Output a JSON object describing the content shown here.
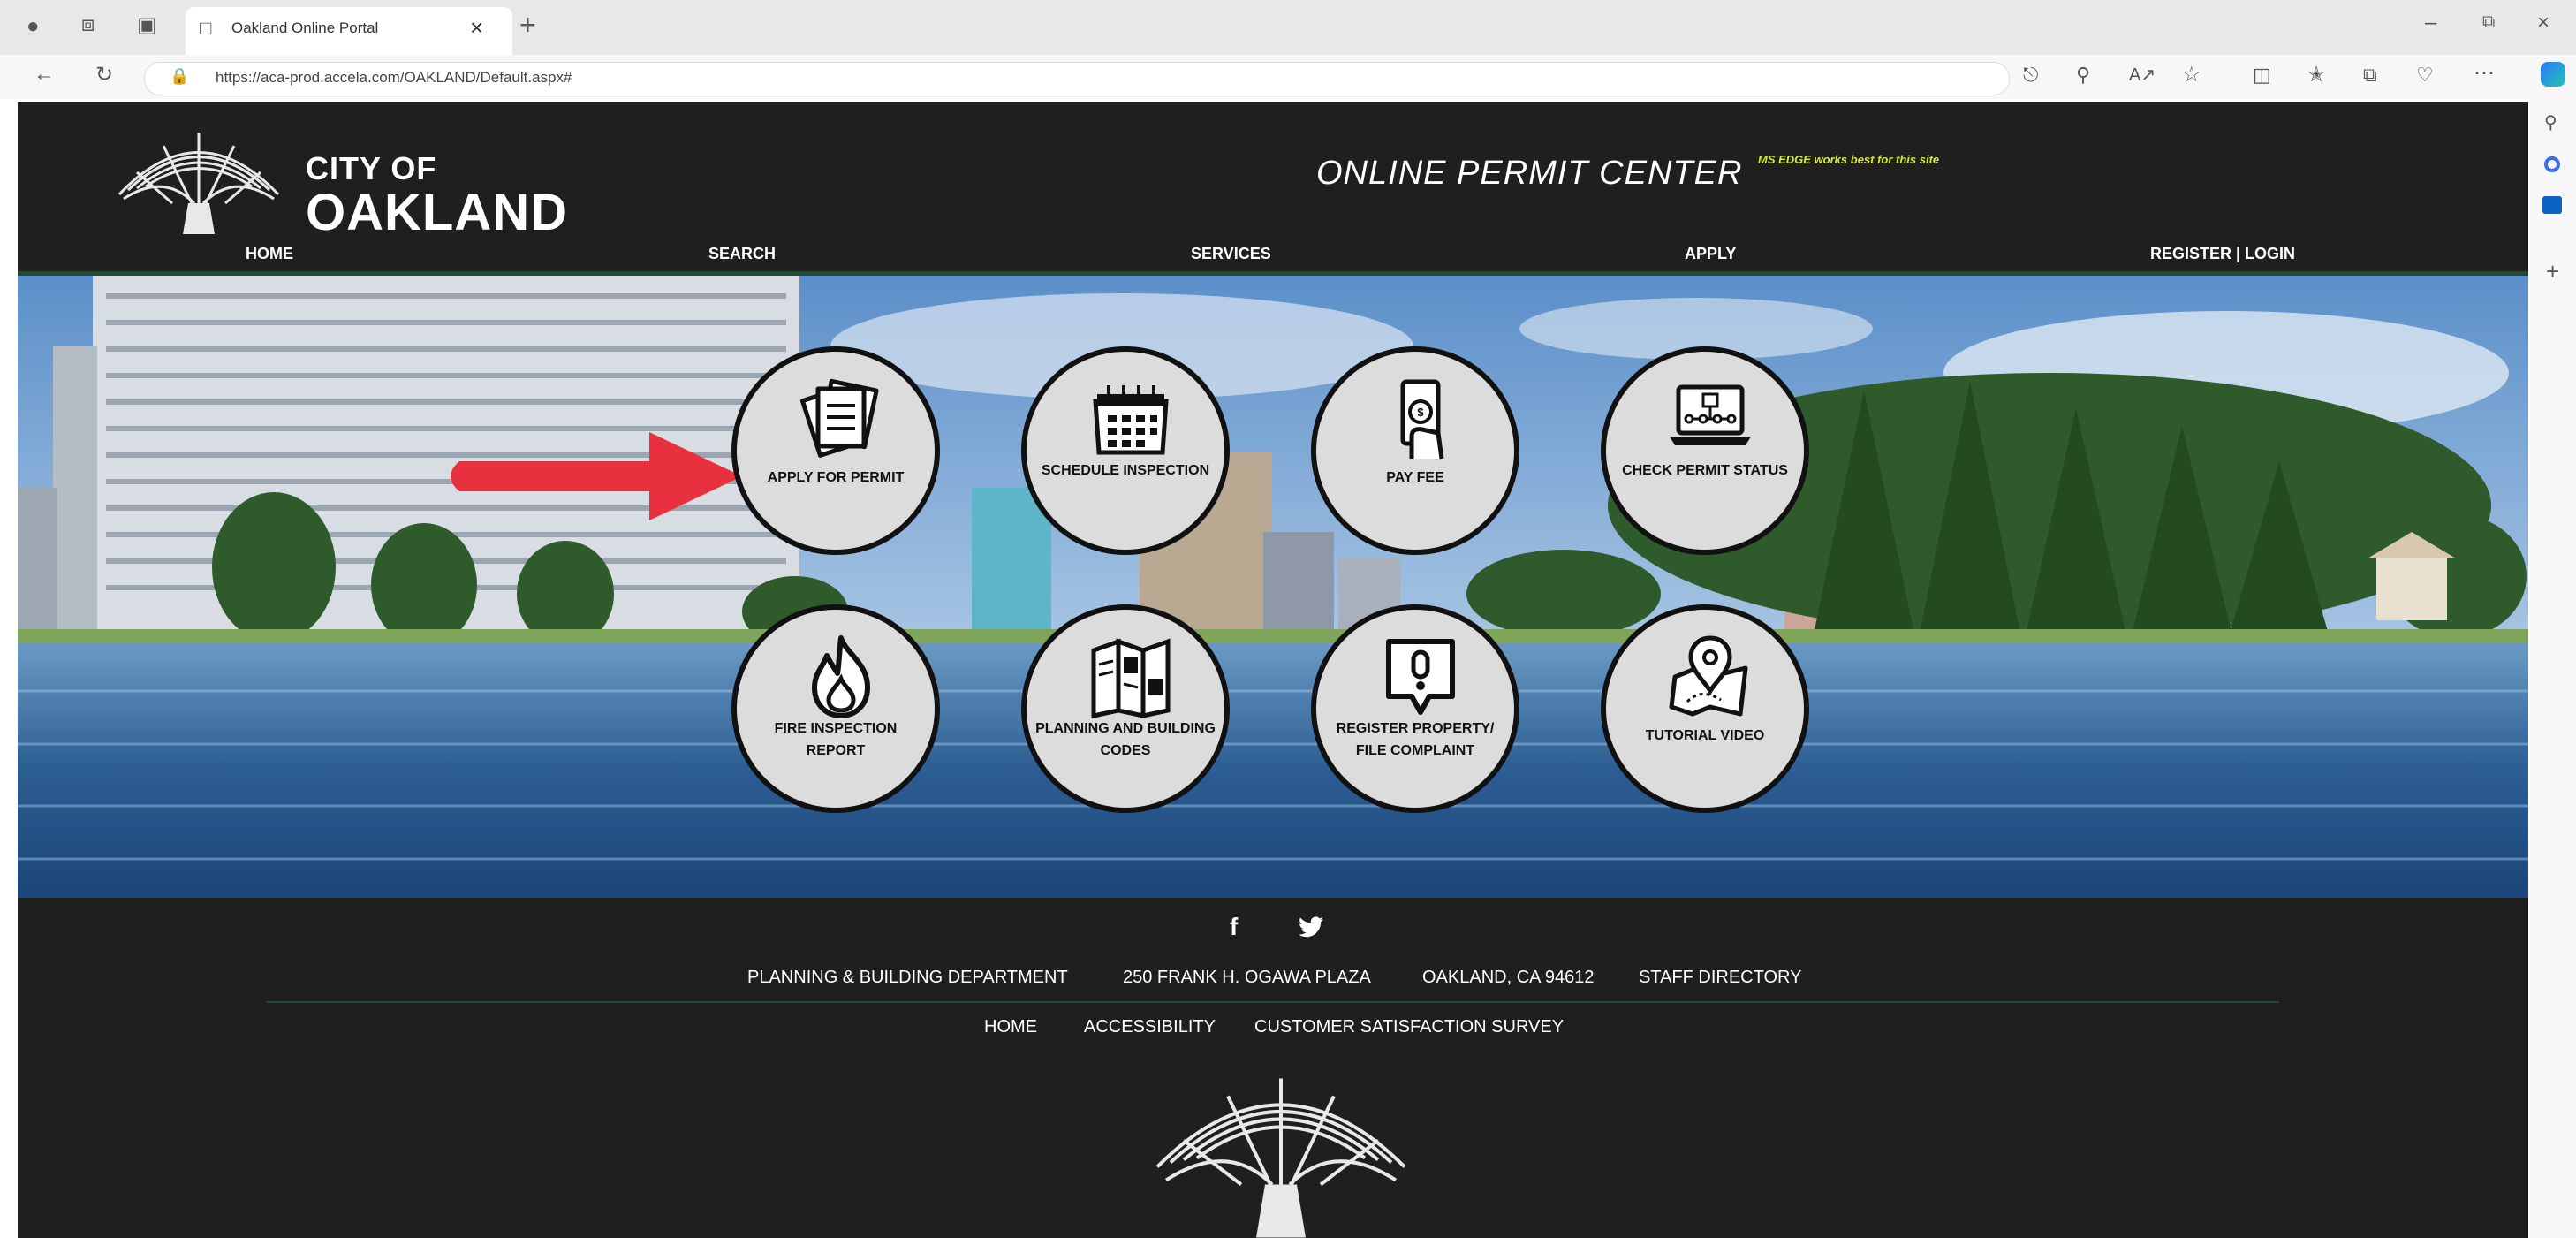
{
  "browser": {
    "tab_title": "Oakland Online Portal",
    "url": "https://aca-prod.accela.com/OAKLAND/Default.aspx#"
  },
  "header": {
    "logo_line1": "CITY OF",
    "logo_line2": "OAKLAND",
    "title": "ONLINE PERMIT CENTER",
    "browser_note": "MS EDGE works best for this site"
  },
  "nav": {
    "home": "HOME",
    "search": "SEARCH",
    "services": "SERVICES",
    "apply": "APPLY",
    "register_login": "REGISTER | LOGIN"
  },
  "services": [
    {
      "label": "APPLY FOR PERMIT",
      "icon": "documents-icon"
    },
    {
      "label": "SCHEDULE INSPECTION",
      "icon": "calendar-icon"
    },
    {
      "label": "PAY FEE",
      "icon": "money-hand-icon"
    },
    {
      "label": "CHECK PERMIT STATUS",
      "icon": "laptop-flow-icon"
    },
    {
      "label": "FIRE INSPECTION REPORT",
      "icon": "flame-icon"
    },
    {
      "label": "PLANNING AND BUILDING CODES",
      "icon": "brochure-icon"
    },
    {
      "label": "REGISTER PROPERTY/ FILE COMPLAINT",
      "icon": "alert-bubble-icon"
    },
    {
      "label": "TUTORIAL VIDEO",
      "icon": "map-pin-icon"
    }
  ],
  "footer": {
    "dept": "PLANNING & BUILDING DEPARTMENT",
    "address": "250 FRANK H. OGAWA PLAZA",
    "city": "OAKLAND, CA 94612",
    "staff": "STAFF DIRECTORY",
    "home": "HOME",
    "accessibility": "ACCESSIBILITY",
    "survey": "CUSTOMER SATISFACTION SURVEY"
  },
  "colors": {
    "page_bg": "#1f1f1f",
    "nav_underline": "#1f4d31",
    "circle_fill": "#dcdcdc",
    "arrow": "#e8303f",
    "note": "#d6e73a"
  }
}
